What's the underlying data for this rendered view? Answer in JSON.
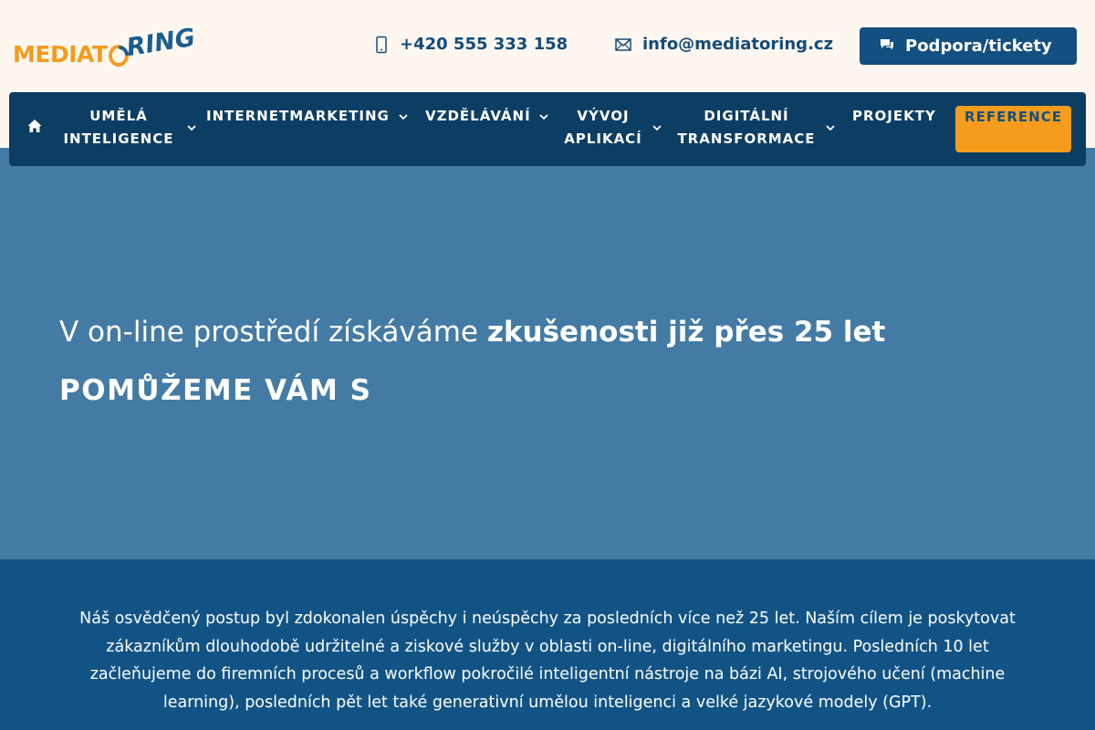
{
  "header": {
    "logo_left": "MEDIAT",
    "logo_right": "RING",
    "phone": "+420 555 333 158",
    "email": "info@mediatoring.cz",
    "support_label": "Podpora/tickety"
  },
  "nav": {
    "items": [
      {
        "line1": "UMĚLÁ",
        "line2": "INTELIGENCE"
      },
      {
        "line1": "INTERNETMARKETING",
        "line2": ""
      },
      {
        "line1": "VZDĚLÁVÁNÍ",
        "line2": ""
      },
      {
        "line1": "VÝVOJ",
        "line2": "APLIKACÍ"
      },
      {
        "line1": "DIGITÁLNÍ",
        "line2": "TRANSFORMACE"
      },
      {
        "line1": "PROJEKTY",
        "line2": ""
      }
    ],
    "reference_label": "REFERENCE"
  },
  "hero": {
    "headline_regular": "V on-line prostředí získáváme ",
    "headline_bold": "zkušenosti již přes 25 let",
    "subheadline": "POMŮŽEME VÁM S"
  },
  "intro": {
    "text": "Náš osvědčený postup byl zdokonalen úspěchy i neúspěchy za posledních více než 25 let. Naším cílem je poskytovat zákazníkům dlouhodobě udržitelné a ziskové služby v oblasti on-line, digitálního marketingu. Posledních 10 let začleňujeme do firemních procesů a workflow pokročilé inteligentní nástroje na bázi AI, strojového učení (machine learning), posledních pět let také generativní umělou inteligenci a velké jazykové modely (GPT)."
  },
  "colors": {
    "brand_orange": "#f39c1f",
    "brand_blue": "#134f80",
    "nav_bg": "#0c3d63",
    "hero_bg": "#447ba4",
    "intro_bg": "#125385"
  },
  "icons": [
    "phone-icon",
    "mail-icon",
    "chat-icon",
    "home-icon",
    "chevron-down-icon"
  ]
}
